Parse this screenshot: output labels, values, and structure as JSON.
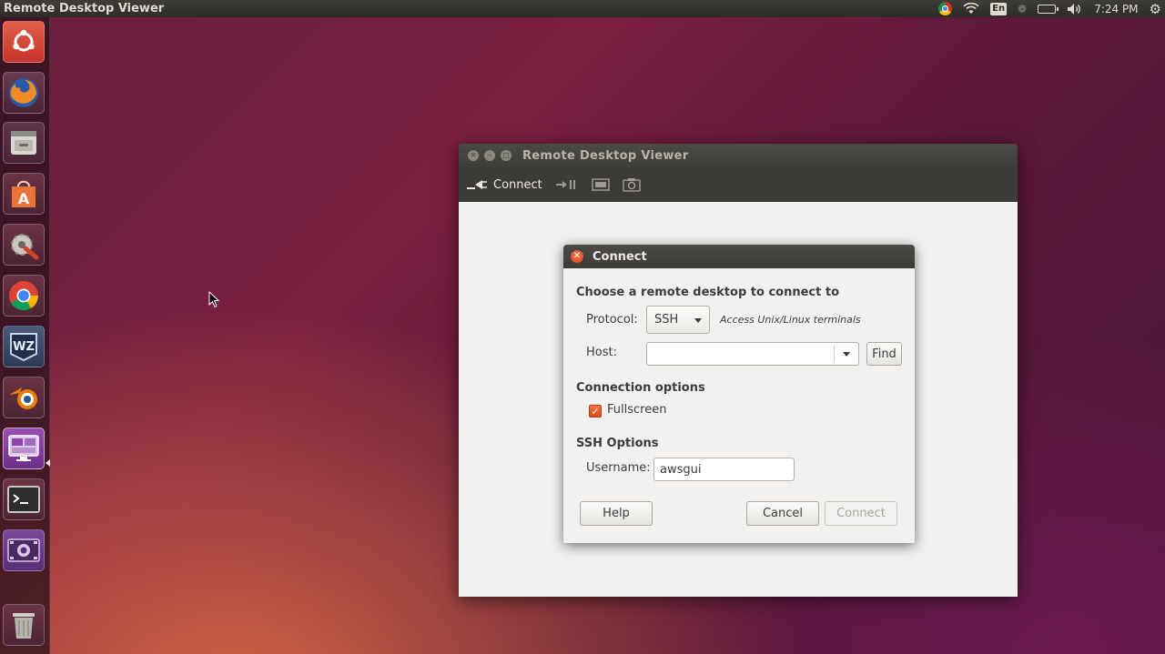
{
  "top_panel": {
    "title": "Remote Desktop Viewer",
    "language": "En",
    "clock": "7:24 PM"
  },
  "launcher": {
    "items": [
      {
        "name": "ubuntu-dash-icon"
      },
      {
        "name": "firefox-icon"
      },
      {
        "name": "files-icon"
      },
      {
        "name": "software-center-icon"
      },
      {
        "name": "system-settings-icon"
      },
      {
        "name": "chrome-icon"
      },
      {
        "name": "warzone-icon"
      },
      {
        "name": "blender-icon"
      },
      {
        "name": "remote-desktop-icon"
      },
      {
        "name": "terminal-icon"
      },
      {
        "name": "webcam-icon"
      },
      {
        "name": "trash-icon"
      }
    ]
  },
  "rdv_window": {
    "title": "Remote Desktop Viewer",
    "toolbar": {
      "connect_label": "Connect"
    }
  },
  "connect_dialog": {
    "title": "Connect",
    "heading": "Choose a remote desktop to connect to",
    "protocol_label": "Protocol:",
    "protocol_value": "SSH",
    "protocol_description": "Access Unix/Linux terminals",
    "host_label": "Host:",
    "host_value": "",
    "find_label": "Find",
    "connection_options_heading": "Connection options",
    "fullscreen_label": "Fullscreen",
    "fullscreen_checked": true,
    "ssh_options_heading": "SSH Options",
    "username_label": "Username:",
    "username_value": "awsgui",
    "help_label": "Help",
    "cancel_label": "Cancel",
    "connect_label": "Connect"
  },
  "colors": {
    "accent": "#dd4814",
    "panel": "#3c3b37",
    "window_bg": "#f2f1f0"
  }
}
